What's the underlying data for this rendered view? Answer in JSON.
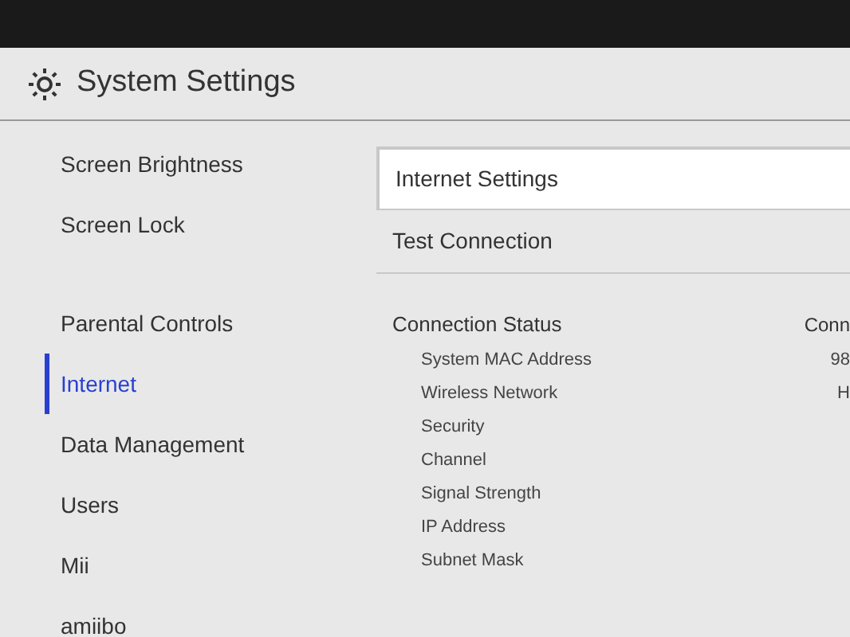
{
  "header": {
    "title": "System Settings"
  },
  "sidebar": {
    "items": [
      {
        "label": "Screen Brightness",
        "selected": false
      },
      {
        "label": "Screen Lock",
        "selected": false
      },
      {
        "label": "Parental Controls",
        "selected": false
      },
      {
        "label": "Internet",
        "selected": true
      },
      {
        "label": "Data Management",
        "selected": false
      },
      {
        "label": "Users",
        "selected": false
      },
      {
        "label": "Mii",
        "selected": false
      },
      {
        "label": "amiibo",
        "selected": false
      }
    ]
  },
  "options": [
    {
      "label": "Internet Settings",
      "selected": true
    },
    {
      "label": "Test Connection",
      "selected": false
    }
  ],
  "status": {
    "title": "Connection Status",
    "column_2": "Conn",
    "rows": [
      {
        "label": "System MAC Address",
        "value": "98"
      },
      {
        "label": "Wireless Network",
        "value": "H"
      },
      {
        "label": "Security"
      },
      {
        "label": "Channel"
      },
      {
        "label": "Signal Strength"
      },
      {
        "label": "IP Address"
      },
      {
        "label": "Subnet Mask"
      }
    ]
  }
}
